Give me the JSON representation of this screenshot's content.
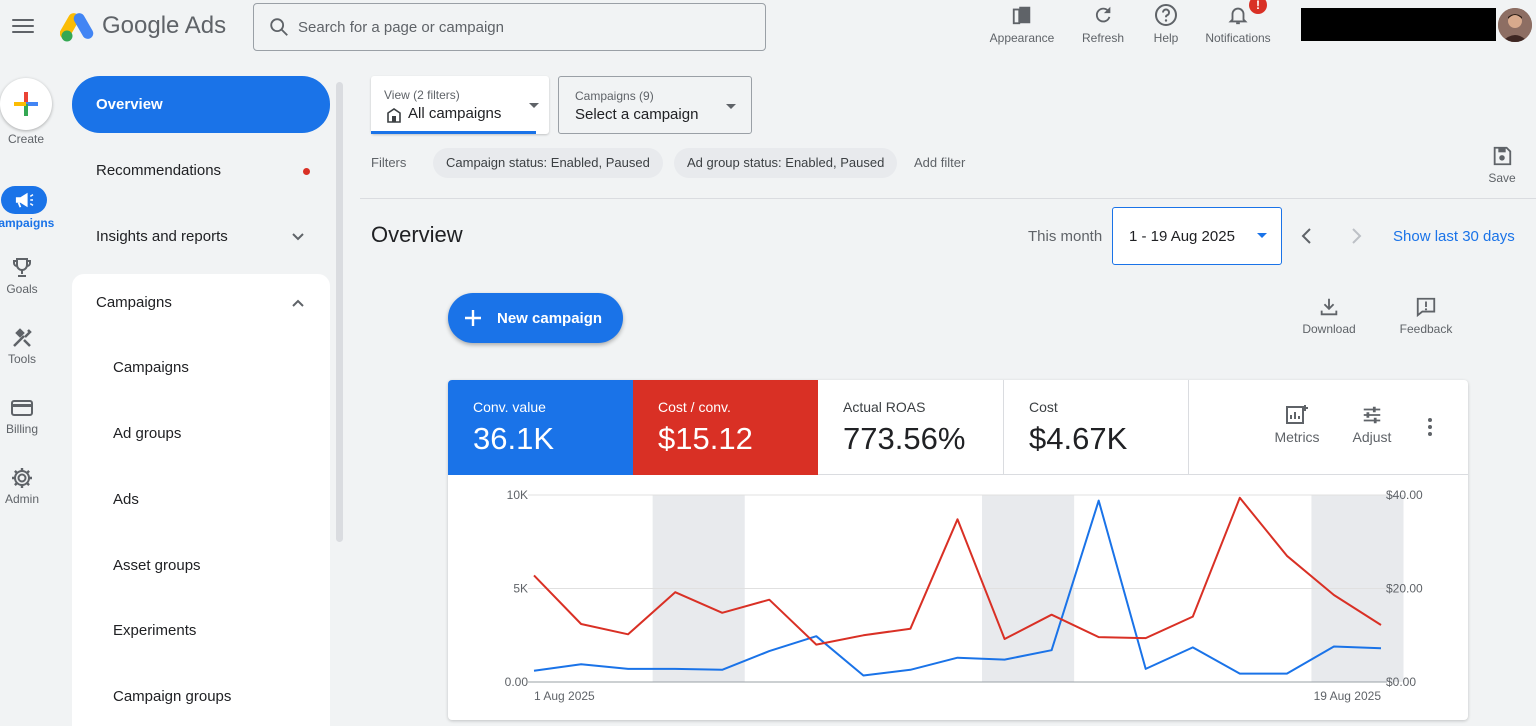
{
  "app": {
    "name": "Google Ads"
  },
  "search": {
    "placeholder": "Search for a page or campaign"
  },
  "top_actions": [
    {
      "label": "Appearance",
      "icon": "appearance-icon"
    },
    {
      "label": "Refresh",
      "icon": "refresh-icon"
    },
    {
      "label": "Help",
      "icon": "help-icon"
    },
    {
      "label": "Notifications",
      "icon": "bell-icon",
      "badge": "!"
    }
  ],
  "rail": [
    {
      "label": "Create",
      "icon": "plus-icon"
    },
    {
      "label": "Campaigns",
      "icon": "megaphone-icon",
      "active": true
    },
    {
      "label": "Goals",
      "icon": "trophy-icon"
    },
    {
      "label": "Tools",
      "icon": "tools-icon"
    },
    {
      "label": "Billing",
      "icon": "credit-card-icon"
    },
    {
      "label": "Admin",
      "icon": "gear-icon"
    }
  ],
  "nav": {
    "overview": "Overview",
    "recommendations": "Recommendations",
    "insights": "Insights and reports",
    "campaigns": "Campaigns",
    "sub_items": [
      "Campaigns",
      "Ad groups",
      "Ads",
      "Asset groups",
      "Experiments",
      "Campaign groups"
    ]
  },
  "view_filter": {
    "label": "View (2 filters)",
    "value": "All campaigns"
  },
  "campaign_filter": {
    "label": "Campaigns (9)",
    "value": "Select a campaign"
  },
  "filters": {
    "label": "Filters",
    "chips": [
      "Campaign status: Enabled, Paused",
      "Ad group status: Enabled, Paused"
    ],
    "add_label": "Add filter"
  },
  "save_label": "Save",
  "overview": {
    "title": "Overview",
    "range_label": "This month",
    "date_range": "1 - 19 Aug 2025",
    "show_last": "Show last 30 days"
  },
  "new_campaign_label": "New campaign",
  "download_label": "Download",
  "feedback_label": "Feedback",
  "metrics": [
    {
      "label": "Conv. value",
      "value": "36.1K",
      "color": "#1a73e8"
    },
    {
      "label": "Cost / conv.",
      "value": "$15.12",
      "color": "#d93025"
    },
    {
      "label": "Actual ROAS",
      "value": "773.56%"
    },
    {
      "label": "Cost",
      "value": "$4.67K"
    }
  ],
  "card_tools": {
    "metrics": "Metrics",
    "adjust": "Adjust"
  },
  "chart_data": {
    "type": "line",
    "x_labels": [
      "1 Aug 2025",
      "19 Aug 2025"
    ],
    "days": 19,
    "left_axis": {
      "ticks": [
        "0.00",
        "5K",
        "10K"
      ],
      "ylim": [
        0,
        10000
      ]
    },
    "right_axis": {
      "ticks": [
        "$0.00",
        "$20.00",
        "$40.00"
      ],
      "ylim": [
        0,
        40
      ]
    },
    "weekend_bands": [
      [
        3,
        4
      ],
      [
        10,
        11
      ],
      [
        17,
        18
      ]
    ],
    "series": [
      {
        "color": "#1a73e8",
        "axis": "left",
        "values": [
          600,
          950,
          700,
          700,
          650,
          1650,
          2450,
          350,
          650,
          1300,
          1200,
          1700,
          9700,
          700,
          1850,
          450,
          450,
          1900,
          1800
        ]
      },
      {
        "color": "#d93025",
        "axis": "right",
        "values": [
          22.8,
          12.4,
          10.2,
          19.2,
          14.8,
          17.6,
          8.0,
          10.0,
          11.4,
          34.8,
          9.2,
          14.4,
          9.6,
          9.4,
          14.0,
          39.4,
          27.0,
          18.6,
          12.2
        ]
      }
    ]
  }
}
